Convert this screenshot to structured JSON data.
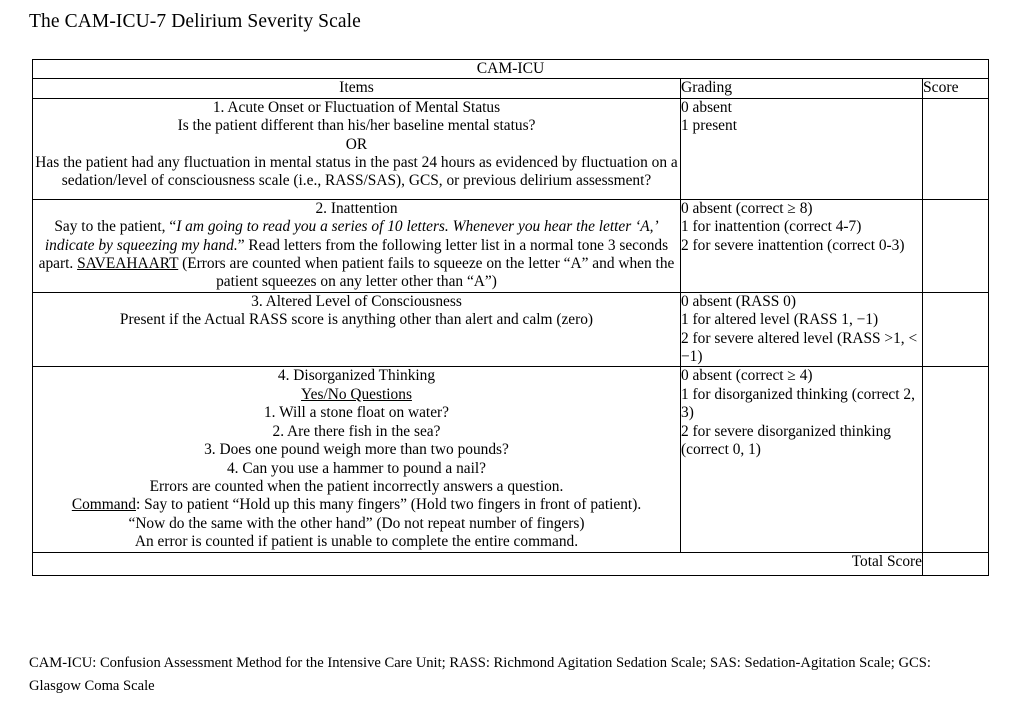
{
  "document": {
    "title": "The CAM-ICU-7 Delirium Severity Scale"
  },
  "table": {
    "caption": "CAM-ICU",
    "columns": {
      "items": "Items",
      "grading": "Grading",
      "score": "Score"
    },
    "rows": [
      {
        "item_lines": [
          "1. Acute Onset or Fluctuation of Mental Status",
          "Is the patient different than his/her baseline mental status?",
          "OR",
          "Has the patient had any fluctuation in mental status in the past 24 hours as evidenced by fluctuation on a sedation/level of consciousness scale (i.e., RASS/SAS), GCS, or previous delirium assessment?"
        ],
        "grading_lines": [
          "0 absent",
          "1 present"
        ],
        "score": ""
      },
      {
        "item_title": "2. Inattention",
        "item_body_part1": "Say to the patient, “",
        "item_body_italic1": "I am going to read you a series of 10 letters. Whenever you hear the letter ‘A,’ indicate by squeezing my hand.",
        "item_body_part2": "” Read letters from the following letter list in a normal tone 3 seconds apart. ",
        "item_body_underline": "SAVEAHAART",
        "item_body_part3": " (Errors are counted when patient fails to squeeze on the letter “A” and when the patient squeezes on any letter other than “A”)",
        "grading_lines": [
          "0 absent (correct ≥ 8)",
          "1 for inattention (correct 4-7)",
          "2 for severe inattention (correct 0-3)"
        ],
        "score": ""
      },
      {
        "item_lines": [
          "3. Altered Level of Consciousness",
          "Present if the Actual RASS score is anything other than alert and calm (zero)"
        ],
        "grading_lines": [
          "0 absent (RASS 0)",
          "1 for altered level (RASS 1, −1)",
          "2 for severe altered level (RASS >1, < −1)"
        ],
        "score": ""
      },
      {
        "item_title": "4. Disorganized Thinking",
        "item_subtitle_underline": "Yes/No Questions",
        "item_questions": [
          "1. Will a stone float on water?",
          "2. Are there fish in the sea?",
          "3. Does one pound weigh more than two pounds?",
          "4. Can you use a hammer to pound a nail?"
        ],
        "item_errors_note": "Errors are counted when the patient incorrectly answers a question.",
        "item_command_label": "Command",
        "item_command_text": ": Say to patient “Hold up this many fingers” (Hold two fingers in front of patient).",
        "item_command_line2": "“Now do the same with the other hand” (Do not repeat number of fingers)",
        "item_command_line3": "An error is counted if patient is unable to complete the entire command.",
        "grading_lines": [
          "0 absent (correct ≥ 4)",
          "1 for disorganized thinking (correct 2, 3)",
          "2 for severe disorganized thinking (correct 0, 1)"
        ],
        "score": ""
      }
    ],
    "total_label": "Total Score",
    "total_value": ""
  },
  "footnote": "CAM-ICU: Confusion Assessment Method for the Intensive Care Unit; RASS: Richmond Agitation Sedation Scale; SAS: Sedation-Agitation Scale; GCS: Glasgow Coma Scale"
}
